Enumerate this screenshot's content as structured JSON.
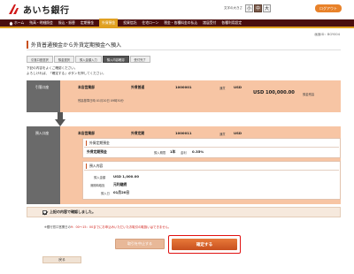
{
  "header": {
    "bank_name": "あいち銀行",
    "font_size_label": "文字の大きさ",
    "font_sizes": [
      "小",
      "中",
      "大"
    ],
    "logout_label": "ログアウト"
  },
  "nav": {
    "items": [
      "ホーム",
      "残高・明細照会",
      "振込・振替",
      "定期預金",
      "外貨預金",
      "投資信託",
      "住宅ローン",
      "税金・各種料金の払込",
      "諸届受付",
      "各種利用設定"
    ],
    "active_index": 4
  },
  "screen_id": "画面ID：BGY004",
  "page_title": "外貨普通預金から外貨定期預金へ預入",
  "steps": [
    "引落口座選択",
    "預金選択",
    "預入金額入力",
    "預入内容確認",
    "受付完了"
  ],
  "active_step": 3,
  "instructions": [
    "下記の内容をよくご確認ください。",
    "よろしければ、「確定する」ボタンを押してください。"
  ],
  "from_account": {
    "label": "引落口座",
    "branch": "本店営業部",
    "type": "外貨普通",
    "number": "1000001",
    "currency_name": "通貨",
    "currency": "USD",
    "balance": "USD 100,000.00",
    "balance_label": "預金残高",
    "date_text": "残高基準日時 01月20日 09時30分"
  },
  "to_account": {
    "label": "預入口座",
    "branch": "本店営業部",
    "type": "外貨定期",
    "number": "1000011",
    "currency_name": "通貨",
    "currency": "USD",
    "deposit_heading": "外貨定期預金",
    "deposit_type": "外貨定期預金",
    "term_label": "預入期間",
    "term_value": "1年",
    "rate_label": "金利",
    "rate_value": "0.35%",
    "content_heading": "預入内容",
    "amount_label": "預入金額",
    "amount_value": "USD 1,000.00",
    "maturity_label": "満期時取扱",
    "maturity_value": "元利継続",
    "date_label": "預入日",
    "date_value": "01月20日"
  },
  "confirm_checkbox_label": "上記の内容で確認しました。",
  "note_prefix": "※銀行窓口営業日の",
  "note_hours": "9：00～15：00までにお申込みいただいたお取引の取扱いはできません。",
  "note_suffix": "",
  "buttons": {
    "cancel": "取引を中止する",
    "confirm": "確定する",
    "back": "戻る"
  },
  "colors": {
    "brand_dark": "#4a0e0e",
    "accent_orange": "#c8501e",
    "panel_peach": "#f7c5a4",
    "highlight_red": "#e01010"
  }
}
